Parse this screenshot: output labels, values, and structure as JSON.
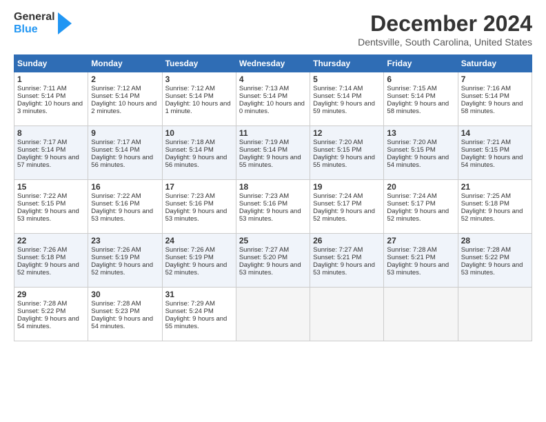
{
  "logo": {
    "line1": "General",
    "line2": "Blue"
  },
  "title": "December 2024",
  "location": "Dentsville, South Carolina, United States",
  "weekdays": [
    "Sunday",
    "Monday",
    "Tuesday",
    "Wednesday",
    "Thursday",
    "Friday",
    "Saturday"
  ],
  "weeks": [
    [
      {
        "day": "1",
        "sr": "Sunrise: 7:11 AM",
        "ss": "Sunset: 5:14 PM",
        "dl": "Daylight: 10 hours and 3 minutes."
      },
      {
        "day": "2",
        "sr": "Sunrise: 7:12 AM",
        "ss": "Sunset: 5:14 PM",
        "dl": "Daylight: 10 hours and 2 minutes."
      },
      {
        "day": "3",
        "sr": "Sunrise: 7:12 AM",
        "ss": "Sunset: 5:14 PM",
        "dl": "Daylight: 10 hours and 1 minute."
      },
      {
        "day": "4",
        "sr": "Sunrise: 7:13 AM",
        "ss": "Sunset: 5:14 PM",
        "dl": "Daylight: 10 hours and 0 minutes."
      },
      {
        "day": "5",
        "sr": "Sunrise: 7:14 AM",
        "ss": "Sunset: 5:14 PM",
        "dl": "Daylight: 9 hours and 59 minutes."
      },
      {
        "day": "6",
        "sr": "Sunrise: 7:15 AM",
        "ss": "Sunset: 5:14 PM",
        "dl": "Daylight: 9 hours and 58 minutes."
      },
      {
        "day": "7",
        "sr": "Sunrise: 7:16 AM",
        "ss": "Sunset: 5:14 PM",
        "dl": "Daylight: 9 hours and 58 minutes."
      }
    ],
    [
      {
        "day": "8",
        "sr": "Sunrise: 7:17 AM",
        "ss": "Sunset: 5:14 PM",
        "dl": "Daylight: 9 hours and 57 minutes."
      },
      {
        "day": "9",
        "sr": "Sunrise: 7:17 AM",
        "ss": "Sunset: 5:14 PM",
        "dl": "Daylight: 9 hours and 56 minutes."
      },
      {
        "day": "10",
        "sr": "Sunrise: 7:18 AM",
        "ss": "Sunset: 5:14 PM",
        "dl": "Daylight: 9 hours and 56 minutes."
      },
      {
        "day": "11",
        "sr": "Sunrise: 7:19 AM",
        "ss": "Sunset: 5:14 PM",
        "dl": "Daylight: 9 hours and 55 minutes."
      },
      {
        "day": "12",
        "sr": "Sunrise: 7:20 AM",
        "ss": "Sunset: 5:15 PM",
        "dl": "Daylight: 9 hours and 55 minutes."
      },
      {
        "day": "13",
        "sr": "Sunrise: 7:20 AM",
        "ss": "Sunset: 5:15 PM",
        "dl": "Daylight: 9 hours and 54 minutes."
      },
      {
        "day": "14",
        "sr": "Sunrise: 7:21 AM",
        "ss": "Sunset: 5:15 PM",
        "dl": "Daylight: 9 hours and 54 minutes."
      }
    ],
    [
      {
        "day": "15",
        "sr": "Sunrise: 7:22 AM",
        "ss": "Sunset: 5:15 PM",
        "dl": "Daylight: 9 hours and 53 minutes."
      },
      {
        "day": "16",
        "sr": "Sunrise: 7:22 AM",
        "ss": "Sunset: 5:16 PM",
        "dl": "Daylight: 9 hours and 53 minutes."
      },
      {
        "day": "17",
        "sr": "Sunrise: 7:23 AM",
        "ss": "Sunset: 5:16 PM",
        "dl": "Daylight: 9 hours and 53 minutes."
      },
      {
        "day": "18",
        "sr": "Sunrise: 7:23 AM",
        "ss": "Sunset: 5:16 PM",
        "dl": "Daylight: 9 hours and 53 minutes."
      },
      {
        "day": "19",
        "sr": "Sunrise: 7:24 AM",
        "ss": "Sunset: 5:17 PM",
        "dl": "Daylight: 9 hours and 52 minutes."
      },
      {
        "day": "20",
        "sr": "Sunrise: 7:24 AM",
        "ss": "Sunset: 5:17 PM",
        "dl": "Daylight: 9 hours and 52 minutes."
      },
      {
        "day": "21",
        "sr": "Sunrise: 7:25 AM",
        "ss": "Sunset: 5:18 PM",
        "dl": "Daylight: 9 hours and 52 minutes."
      }
    ],
    [
      {
        "day": "22",
        "sr": "Sunrise: 7:26 AM",
        "ss": "Sunset: 5:18 PM",
        "dl": "Daylight: 9 hours and 52 minutes."
      },
      {
        "day": "23",
        "sr": "Sunrise: 7:26 AM",
        "ss": "Sunset: 5:19 PM",
        "dl": "Daylight: 9 hours and 52 minutes."
      },
      {
        "day": "24",
        "sr": "Sunrise: 7:26 AM",
        "ss": "Sunset: 5:19 PM",
        "dl": "Daylight: 9 hours and 52 minutes."
      },
      {
        "day": "25",
        "sr": "Sunrise: 7:27 AM",
        "ss": "Sunset: 5:20 PM",
        "dl": "Daylight: 9 hours and 53 minutes."
      },
      {
        "day": "26",
        "sr": "Sunrise: 7:27 AM",
        "ss": "Sunset: 5:21 PM",
        "dl": "Daylight: 9 hours and 53 minutes."
      },
      {
        "day": "27",
        "sr": "Sunrise: 7:28 AM",
        "ss": "Sunset: 5:21 PM",
        "dl": "Daylight: 9 hours and 53 minutes."
      },
      {
        "day": "28",
        "sr": "Sunrise: 7:28 AM",
        "ss": "Sunset: 5:22 PM",
        "dl": "Daylight: 9 hours and 53 minutes."
      }
    ],
    [
      {
        "day": "29",
        "sr": "Sunrise: 7:28 AM",
        "ss": "Sunset: 5:22 PM",
        "dl": "Daylight: 9 hours and 54 minutes."
      },
      {
        "day": "30",
        "sr": "Sunrise: 7:28 AM",
        "ss": "Sunset: 5:23 PM",
        "dl": "Daylight: 9 hours and 54 minutes."
      },
      {
        "day": "31",
        "sr": "Sunrise: 7:29 AM",
        "ss": "Sunset: 5:24 PM",
        "dl": "Daylight: 9 hours and 55 minutes."
      },
      null,
      null,
      null,
      null
    ]
  ]
}
